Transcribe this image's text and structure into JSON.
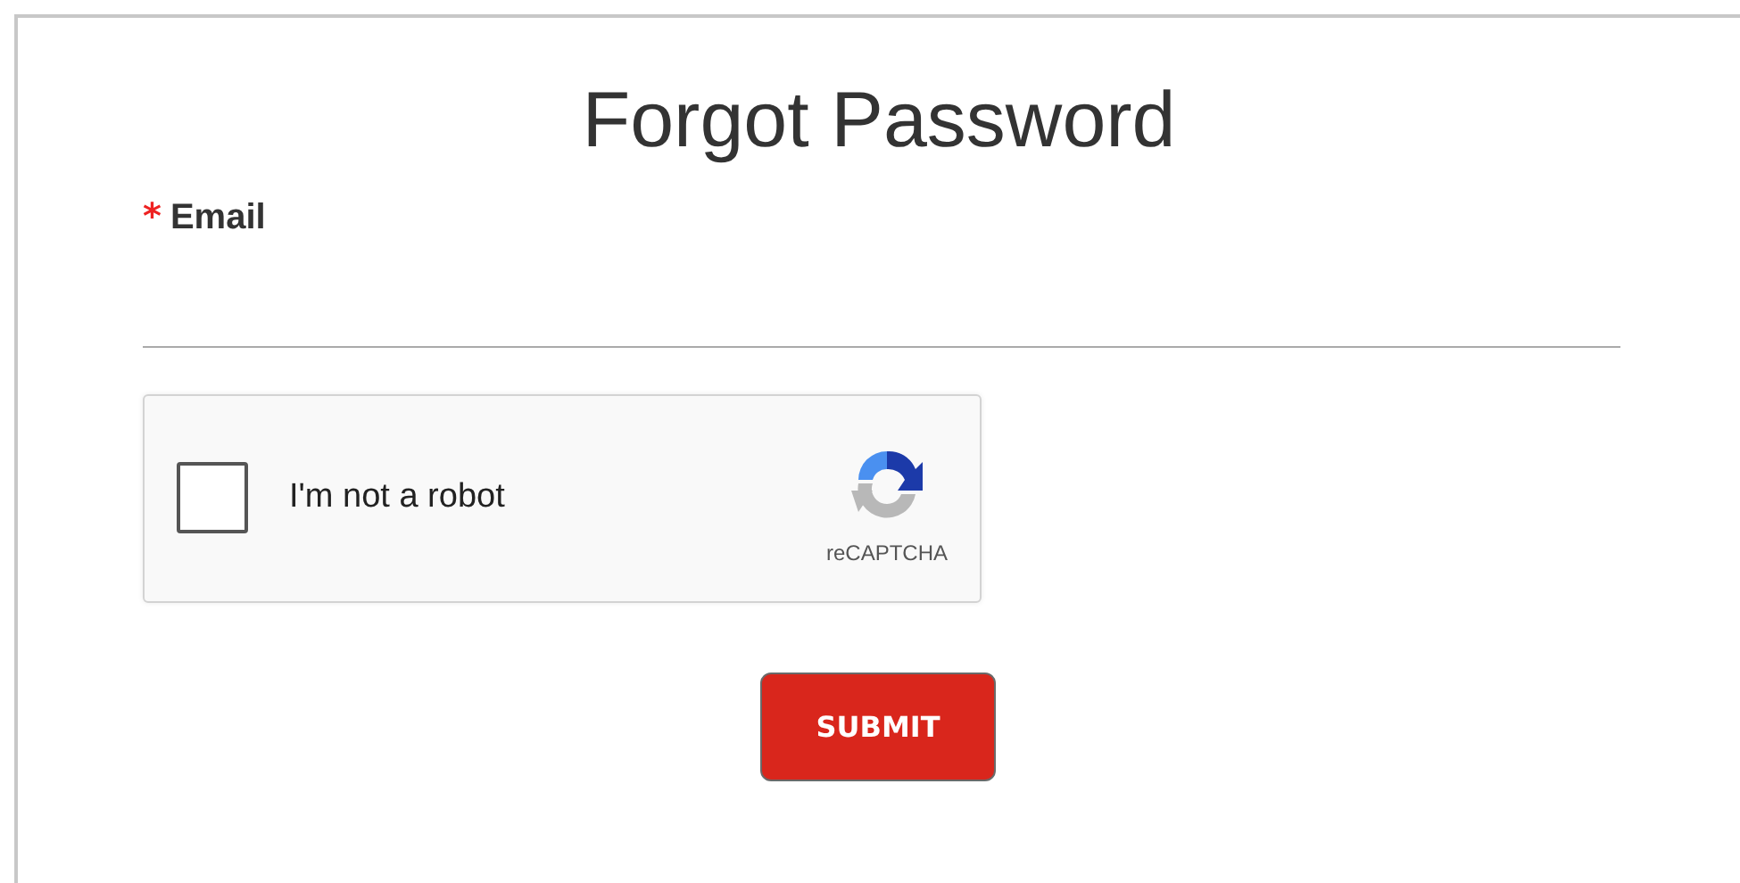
{
  "title": "Forgot Password",
  "email": {
    "required_mark": "*",
    "label": "Email"
  },
  "captcha": {
    "label": "I'm not a robot",
    "checked": false,
    "brand": "reCAPTCHA"
  },
  "submit": {
    "label": "SUBMIT"
  }
}
